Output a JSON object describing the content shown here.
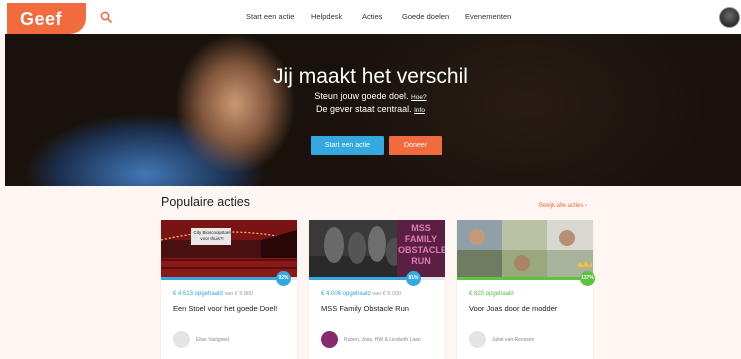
{
  "header": {
    "logo": "Geef",
    "nav": [
      "Start een actie",
      "Helpdesk",
      "Acties",
      "Goede doelen",
      "Evenementen"
    ]
  },
  "hero": {
    "title": "Jij maakt het verschil",
    "line1": "Steun jouw goede doel.",
    "line1_link": "Hoe?",
    "line2": "De gever staat centraal.",
    "line2_link": "Info",
    "btn_start": "Start een actie",
    "btn_doneer": "Doneer"
  },
  "section": {
    "title": "Populaire acties",
    "see_all": "Bekijk alle acties ›"
  },
  "cards": [
    {
      "raised": "€ 4.613 opgehaald",
      "of": "van € 5.000",
      "percent": "92%",
      "progress": 0.92,
      "title": "Een Stoel voor het goede Doel!",
      "author": "Elise Vastgoed",
      "img_text": "City Bioscoopstoel voor thuis?!",
      "color": "#34a9e0"
    },
    {
      "raised": "€ 4.006 opgehaald",
      "of": "van € 5.000",
      "percent": "81%",
      "progress": 0.81,
      "title": "MSS Family Obstacle Run",
      "author": "Ruben, Joas, HW & Liesbeth Laan",
      "img_text": "MSS FAMILY OBSTACLE RUN",
      "color": "#34a9e0"
    },
    {
      "raised": "€ 820 opgehaald",
      "of": "",
      "percent": "137%",
      "progress": 1.0,
      "title": "Voor Joas door de modder",
      "author": "Juliet van Renssen",
      "img_text": "",
      "color": "#5cc23f"
    }
  ],
  "colors": {
    "brand": "#f26b3e",
    "accent": "#34a9e0",
    "success": "#5cc23f"
  }
}
